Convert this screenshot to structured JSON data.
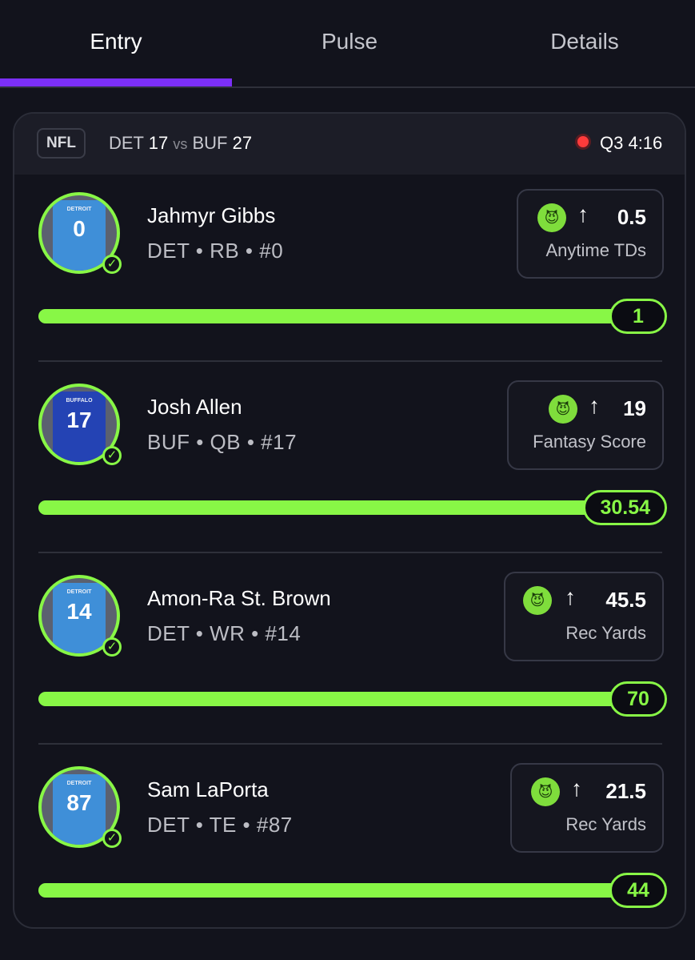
{
  "tabs": [
    {
      "label": "Entry",
      "active": true
    },
    {
      "label": "Pulse",
      "active": false
    },
    {
      "label": "Details",
      "active": false
    }
  ],
  "game": {
    "league": "NFL",
    "team1": "DET",
    "score1": "17",
    "vs": "vs",
    "team2": "BUF",
    "score2": "27",
    "clock": "Q3 4:16"
  },
  "players": [
    {
      "name": "Jahmyr Gibbs",
      "meta": "DET • RB • #0",
      "jersey_team": "DETROIT",
      "jersey_number": "0",
      "direction": "↑",
      "line": "0.5",
      "stat": "Anytime TDs",
      "result": "1",
      "progress": 1.0
    },
    {
      "name": "Josh Allen",
      "meta": "BUF • QB • #17",
      "jersey_team": "BUFFALO",
      "jersey_number": "17",
      "direction": "↑",
      "line": "19",
      "stat": "Fantasy Score",
      "result": "30.54",
      "progress": 1.0
    },
    {
      "name": "Amon-Ra St. Brown",
      "meta": "DET • WR • #14",
      "jersey_team": "DETROIT",
      "jersey_number": "14",
      "direction": "↑",
      "line": "45.5",
      "stat": "Rec Yards",
      "result": "70",
      "progress": 1.0
    },
    {
      "name": "Sam LaPorta",
      "meta": "DET • TE • #87",
      "jersey_team": "DETROIT",
      "jersey_number": "87",
      "direction": "↑",
      "line": "21.5",
      "stat": "Rec Yards",
      "result": "44",
      "progress": 1.0
    }
  ],
  "colors": {
    "accent": "#88f746",
    "tab_indicator": "#7b2ff7",
    "live": "#ff3b3b",
    "background": "#12131c"
  },
  "icons": {
    "pick_badge": "devil-icon",
    "direction": "arrow-up-icon",
    "status": "check-circle-icon",
    "live": "live-dot-icon"
  }
}
